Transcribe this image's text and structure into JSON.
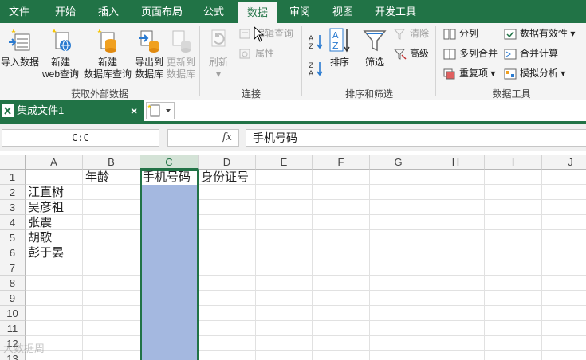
{
  "menu": {
    "tabs": [
      {
        "label": "文件"
      },
      {
        "label": "开始"
      },
      {
        "label": "插入"
      },
      {
        "label": "页面布局"
      },
      {
        "label": "公式"
      },
      {
        "label": "数据"
      },
      {
        "label": "审阅"
      },
      {
        "label": "视图"
      },
      {
        "label": "开发工具"
      }
    ],
    "active": "数据"
  },
  "ribbon": {
    "groups": {
      "external": "获取外部数据",
      "connections": "连接",
      "sort_filter": "排序和筛选",
      "data_tools": "数据工具"
    },
    "import_data": "导入数据",
    "new_web_query_1": "新建",
    "new_web_query_2": "web查询",
    "new_db_query_1": "新建",
    "new_db_query_2": "数据库查询",
    "export_db_1": "导出到",
    "export_db_2": "数据库",
    "update_db_1": "更新到",
    "update_db_2": "数据库",
    "refresh": "刷新",
    "edit_query": "编辑查询",
    "properties": "属性",
    "sort": "排序",
    "filter": "筛选",
    "clear": "清除",
    "advanced": "高级",
    "split": "分列",
    "multi_merge": "多列合并",
    "duplicates": "重复项",
    "validation": "数据有效性",
    "consolidate": "合并计算",
    "what_if": "模拟分析"
  },
  "document": {
    "title": "集成文件1",
    "close": "×"
  },
  "formula_bar": {
    "name_box": "C:C",
    "fx": "fx",
    "content": "手机号码"
  },
  "sheet": {
    "columns": [
      "A",
      "B",
      "C",
      "D",
      "E",
      "F",
      "G",
      "H",
      "I",
      "J"
    ],
    "selected_column": "C",
    "rows": [
      "1",
      "2",
      "3",
      "4",
      "5",
      "6",
      "7",
      "8",
      "9",
      "10",
      "11",
      "12",
      "13"
    ],
    "cells": {
      "B1": "年龄",
      "C1": "手机号码",
      "D1": "身份证号",
      "A2": "江直树",
      "A3": "吴彦祖",
      "A4": "张震",
      "A5": "胡歌",
      "A6": "彭于晏"
    }
  },
  "watermark": "大数据周",
  "colors": {
    "accent": "#217346",
    "selection": "#a4b8e0"
  }
}
